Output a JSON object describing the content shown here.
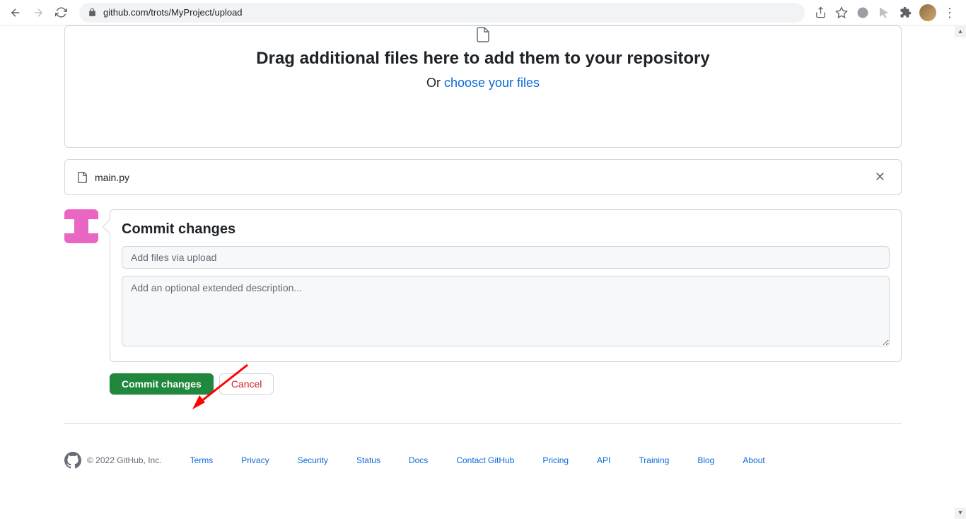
{
  "browser": {
    "url": "github.com/trots/MyProject/upload"
  },
  "dropzone": {
    "title": "Drag additional files here to add them to your repository",
    "or_text": "Or ",
    "choose_link": "choose your files"
  },
  "files": [
    {
      "name": "main.py"
    }
  ],
  "commit": {
    "heading": "Commit changes",
    "summary_placeholder": "Add files via upload",
    "description_placeholder": "Add an optional extended description...",
    "commit_button": "Commit changes",
    "cancel_button": "Cancel"
  },
  "footer": {
    "copyright": "© 2022 GitHub, Inc.",
    "links": [
      "Terms",
      "Privacy",
      "Security",
      "Status",
      "Docs",
      "Contact GitHub",
      "Pricing",
      "API",
      "Training",
      "Blog",
      "About"
    ]
  }
}
